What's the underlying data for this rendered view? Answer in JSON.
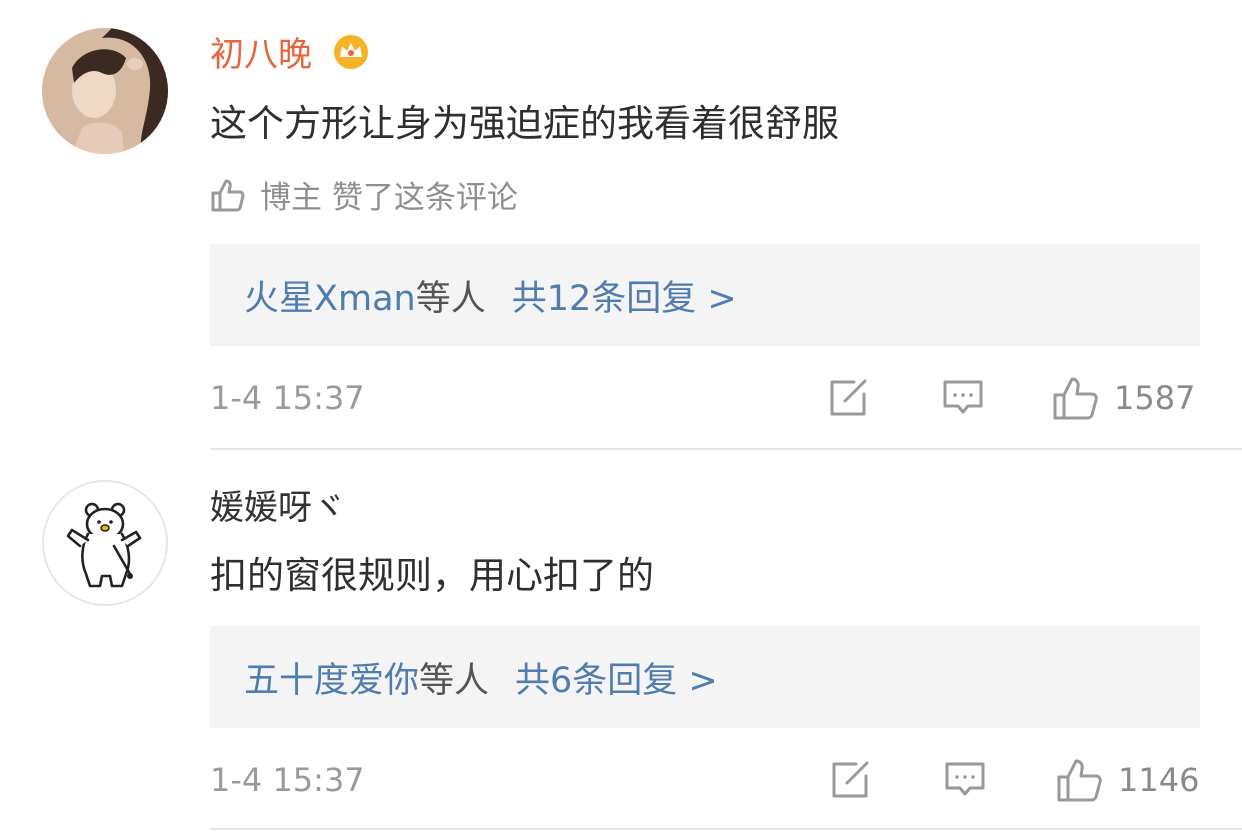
{
  "comments": [
    {
      "avatar_icon": "woman-portrait-avatar",
      "username": "初八晚",
      "username_color": "#e8643c",
      "badge_icon": "crown-icon",
      "text": "这个方形让身为强迫症的我看着很舒服",
      "liked_by_author": "博主 赞了这条评论",
      "reply_preview": {
        "names": "火星Xman",
        "suffix": "等人",
        "count_text": "共12条回复 >"
      },
      "time": "1-4 15:37",
      "likes": "1587"
    },
    {
      "avatar_icon": "bear-avatar",
      "username": "媛媛呀ヾ",
      "username_color": "#333333",
      "text": "扣的窗很规则，用心扣了的",
      "reply_preview": {
        "names": "五十度爱你",
        "suffix": "等人",
        "count_text": "共6条回复 >"
      },
      "time": "1-4 15:37",
      "likes": "1146"
    }
  ],
  "colors": {
    "link": "#4f7dae",
    "background": "#ffffff",
    "reply_box": "#f4f4f4",
    "icon_gray": "#999999"
  }
}
